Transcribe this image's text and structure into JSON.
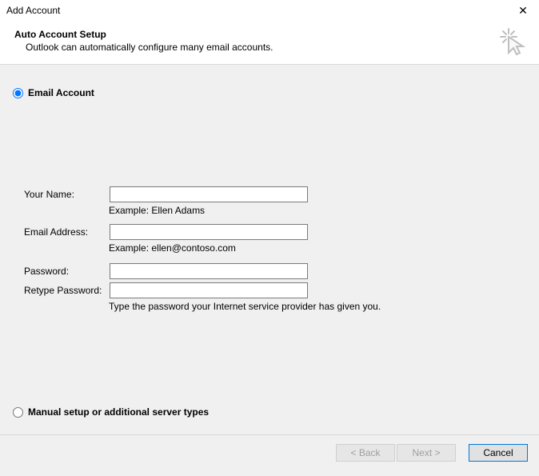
{
  "window": {
    "title": "Add Account",
    "close_glyph": "✕"
  },
  "header": {
    "title": "Auto Account Setup",
    "subtitle": "Outlook can automatically configure many email accounts."
  },
  "radios": {
    "email_account": "Email Account",
    "manual_setup": "Manual setup or additional server types"
  },
  "form": {
    "your_name_label": "Your Name:",
    "your_name_value": "",
    "your_name_hint": "Example: Ellen Adams",
    "email_label": "Email Address:",
    "email_value": "",
    "email_hint": "Example: ellen@contoso.com",
    "password_label": "Password:",
    "password_value": "",
    "retype_label": "Retype Password:",
    "retype_value": "",
    "password_hint": "Type the password your Internet service provider has given you."
  },
  "footer": {
    "back": "< Back",
    "next": "Next >",
    "cancel": "Cancel"
  }
}
